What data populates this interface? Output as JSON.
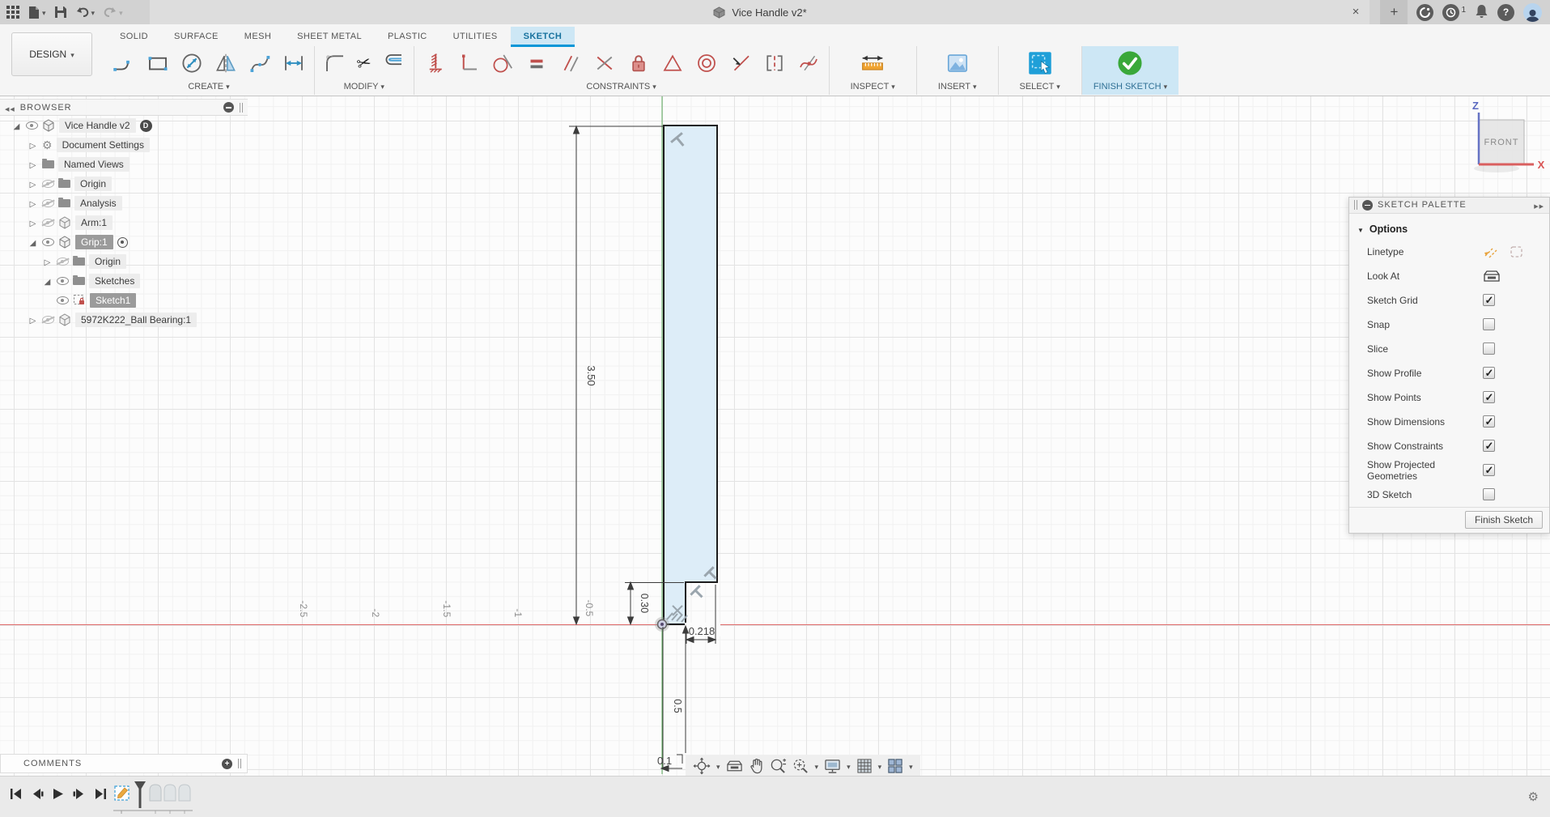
{
  "titlebar": {
    "title": "Vice Handle v2*",
    "job_count": "1"
  },
  "tabs": {
    "items": [
      {
        "label": "SOLID"
      },
      {
        "label": "SURFACE"
      },
      {
        "label": "MESH"
      },
      {
        "label": "SHEET METAL"
      },
      {
        "label": "PLASTIC"
      },
      {
        "label": "UTILITIES"
      },
      {
        "label": "SKETCH",
        "active": true
      }
    ]
  },
  "ribbon": {
    "design_label": "DESIGN",
    "groups": [
      {
        "label": "CREATE"
      },
      {
        "label": "MODIFY"
      },
      {
        "label": "CONSTRAINTS"
      },
      {
        "label": "INSPECT"
      },
      {
        "label": "INSERT"
      },
      {
        "label": "SELECT"
      },
      {
        "label": "FINISH SKETCH"
      }
    ]
  },
  "browser": {
    "header": "BROWSER",
    "badge": "D",
    "items": [
      {
        "label": "Vice Handle v2"
      },
      {
        "label": "Document Settings"
      },
      {
        "label": "Named Views"
      },
      {
        "label": "Origin"
      },
      {
        "label": "Analysis"
      },
      {
        "label": "Arm:1"
      },
      {
        "label": "Grip:1",
        "selected": true
      },
      {
        "label": "Origin"
      },
      {
        "label": "Sketches"
      },
      {
        "label": "Sketch1",
        "selected": true
      },
      {
        "label": "5972K222_Ball Bearing:1"
      }
    ]
  },
  "palette": {
    "header": "SKETCH PALETTE",
    "section_label": "Options",
    "options": [
      {
        "label": "Linetype"
      },
      {
        "label": "Look At"
      },
      {
        "label": "Sketch Grid",
        "checked": true
      },
      {
        "label": "Snap",
        "checked": false
      },
      {
        "label": "Slice",
        "checked": false
      },
      {
        "label": "Show Profile",
        "checked": true
      },
      {
        "label": "Show Points",
        "checked": true
      },
      {
        "label": "Show Dimensions",
        "checked": true
      },
      {
        "label": "Show Constraints",
        "checked": true
      },
      {
        "label": "Show Projected Geometries",
        "checked": true
      },
      {
        "label": "3D Sketch",
        "checked": false
      }
    ],
    "finish_button": "Finish Sketch"
  },
  "viewcube": {
    "face": "FRONT",
    "axis_vertical": "Z",
    "axis_horizontal": "X"
  },
  "canvas": {
    "dimensions": {
      "overall_height": "3.50",
      "step_height": "0.30",
      "notch_width": "0.218",
      "lower_segment": "0.5",
      "partial": "0.1"
    },
    "grid_labels": [
      "-2.5",
      "-2",
      "-1.5",
      "-1",
      "-0.5"
    ]
  },
  "comments": {
    "header": "COMMENTS"
  },
  "colors": {
    "accent_blue": "#0696d7",
    "select_blue": "#1f9fd8",
    "finish_green": "#3aa83a",
    "constraint_red": "#c0504d",
    "axis_x_red": "#e06b6b",
    "axis_y_green": "#58a758",
    "profile_fill": "#ddedf8",
    "selection_gray": "#9b9b9b"
  }
}
